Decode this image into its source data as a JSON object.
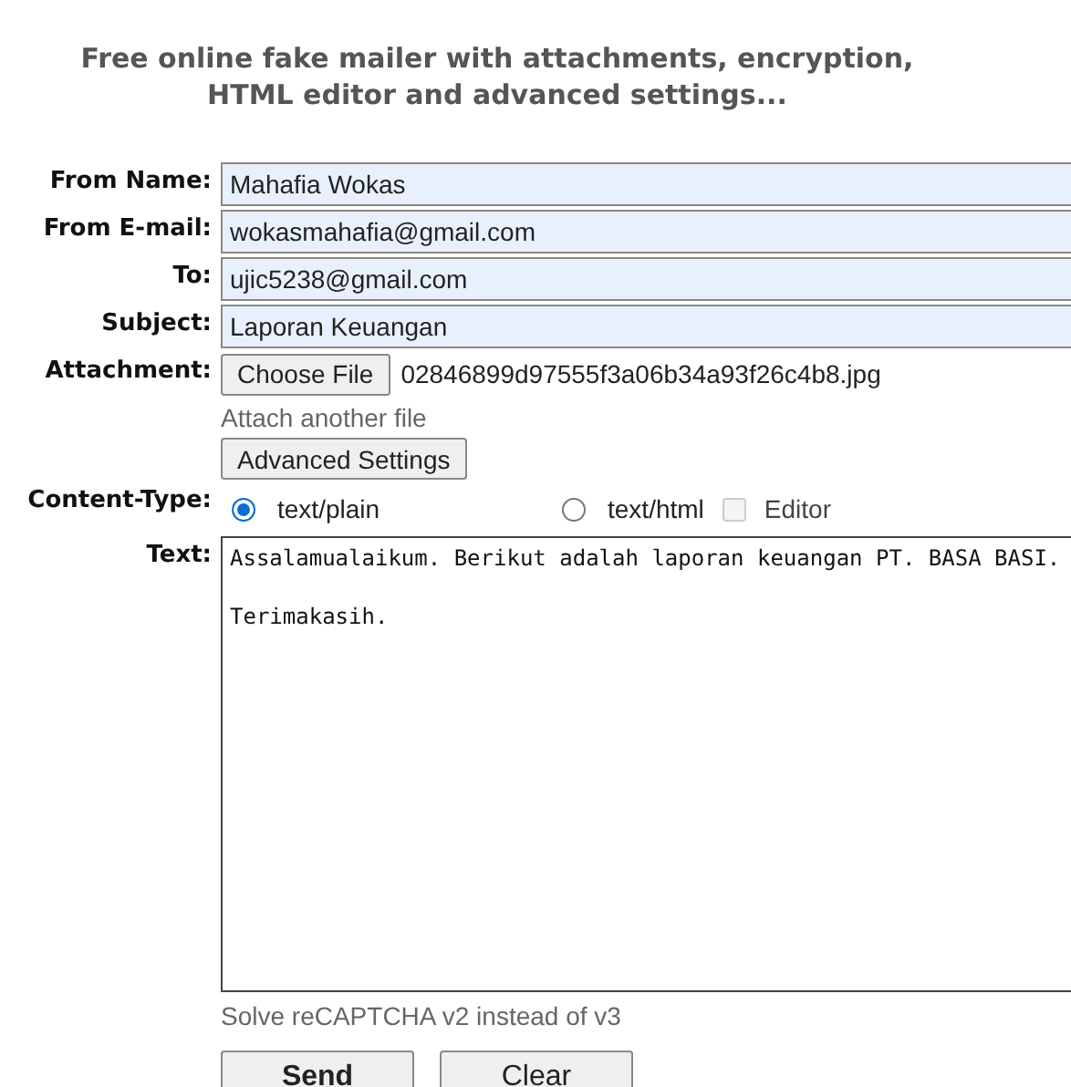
{
  "heading": [
    "Free online fake mailer with attachments, encryption,",
    "HTML editor and advanced settings..."
  ],
  "fields": [
    {
      "label": "From Name:",
      "value": "Mahafia Wokas"
    },
    {
      "label": "From E-mail:",
      "value": "wokasmahafia@gmail.com"
    },
    {
      "label": "To:",
      "value": "ujic5238@gmail.com"
    },
    {
      "label": "Subject:",
      "value": "Laporan Keuangan"
    }
  ],
  "attachment": {
    "label": "Attachment:",
    "button": "Choose File",
    "file_name": "02846899d97555f3a06b34a93f26c4b8.jpg",
    "link": "Attach another file"
  },
  "advanced_button": "Advanced Settings",
  "content_type": {
    "label": "Content-Type:",
    "options": [
      {
        "label": "text/plain",
        "selected": true
      },
      {
        "label": "text/html",
        "selected": false
      }
    ],
    "editor": {
      "label": "Editor",
      "checked": false,
      "disabled": true
    }
  },
  "text": {
    "label": "Text:",
    "value": "Assalamualaikum. Berikut adalah laporan keuangan PT. BASA BASI.\n\nTerimakasih."
  },
  "captcha_link": "Solve reCAPTCHA v2 instead of v3",
  "buttons": [
    {
      "label": "Send",
      "kind": "primary"
    },
    {
      "label": "Clear",
      "kind": "secondary"
    }
  ]
}
